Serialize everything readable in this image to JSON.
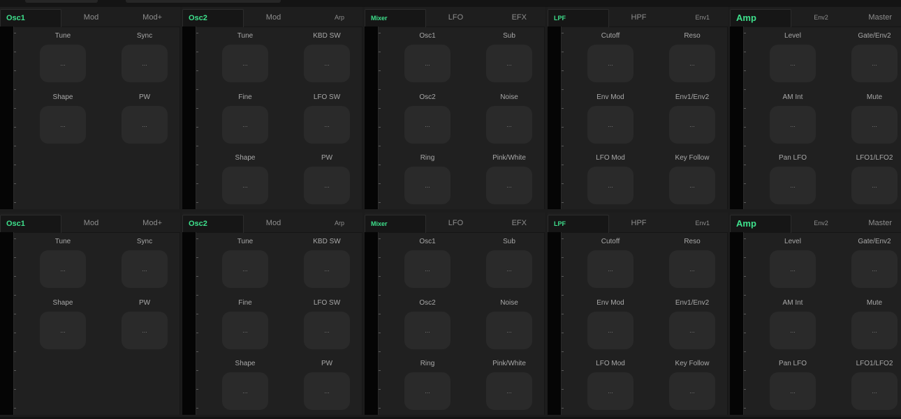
{
  "empty_value": "...",
  "rows": [
    {
      "panels": [
        {
          "tabs": [
            {
              "label": "Osc1",
              "active": true
            },
            {
              "label": "Mod"
            },
            {
              "label": "Mod+"
            }
          ],
          "params": [
            [
              "Tune",
              "Sync"
            ],
            [
              "Shape",
              "PW"
            ]
          ]
        },
        {
          "tabs": [
            {
              "label": "Osc2",
              "active": true
            },
            {
              "label": "Mod"
            },
            {
              "label": "Arp",
              "small": true
            }
          ],
          "params": [
            [
              "Tune",
              "KBD SW"
            ],
            [
              "Fine",
              "LFO SW"
            ],
            [
              "Shape",
              "PW"
            ]
          ]
        },
        {
          "tabs": [
            {
              "label": "Mixer",
              "active": true,
              "small": true
            },
            {
              "label": "LFO"
            },
            {
              "label": "EFX"
            }
          ],
          "params": [
            [
              "Osc1",
              "Sub"
            ],
            [
              "Osc2",
              "Noise"
            ],
            [
              "Ring",
              "Pink/White"
            ]
          ]
        },
        {
          "tabs": [
            {
              "label": "LPF",
              "active": true,
              "small": true
            },
            {
              "label": "HPF"
            },
            {
              "label": "Env1",
              "small": true
            }
          ],
          "params": [
            [
              "Cutoff",
              "Reso"
            ],
            [
              "Env Mod",
              "Env1/Env2"
            ],
            [
              "LFO Mod",
              "Key Follow"
            ]
          ]
        },
        {
          "tabs": [
            {
              "label": "Amp",
              "active": true,
              "big": true
            },
            {
              "label": "Env2",
              "small": true
            },
            {
              "label": "Master"
            }
          ],
          "params": [
            [
              "Level",
              "Gate/Env2"
            ],
            [
              "AM Int",
              "Mute"
            ],
            [
              "Pan LFO",
              "LFO1/LFO2"
            ]
          ]
        }
      ]
    },
    {
      "panels": [
        {
          "tabs": [
            {
              "label": "Osc1",
              "active": true
            },
            {
              "label": "Mod"
            },
            {
              "label": "Mod+"
            }
          ],
          "params": [
            [
              "Tune",
              "Sync"
            ],
            [
              "Shape",
              "PW"
            ]
          ]
        },
        {
          "tabs": [
            {
              "label": "Osc2",
              "active": true
            },
            {
              "label": "Mod"
            },
            {
              "label": "Arp",
              "small": true
            }
          ],
          "params": [
            [
              "Tune",
              "KBD SW"
            ],
            [
              "Fine",
              "LFO SW"
            ],
            [
              "Shape",
              "PW"
            ]
          ]
        },
        {
          "tabs": [
            {
              "label": "Mixer",
              "active": true,
              "small": true
            },
            {
              "label": "LFO"
            },
            {
              "label": "EFX"
            }
          ],
          "params": [
            [
              "Osc1",
              "Sub"
            ],
            [
              "Osc2",
              "Noise"
            ],
            [
              "Ring",
              "Pink/White"
            ]
          ]
        },
        {
          "tabs": [
            {
              "label": "LPF",
              "active": true,
              "small": true
            },
            {
              "label": "HPF"
            },
            {
              "label": "Env1",
              "small": true
            }
          ],
          "params": [
            [
              "Cutoff",
              "Reso"
            ],
            [
              "Env Mod",
              "Env1/Env2"
            ],
            [
              "LFO Mod",
              "Key Follow"
            ]
          ]
        },
        {
          "tabs": [
            {
              "label": "Amp",
              "active": true,
              "big": true
            },
            {
              "label": "Env2",
              "small": true
            },
            {
              "label": "Master"
            }
          ],
          "params": [
            [
              "Level",
              "Gate/Env2"
            ],
            [
              "AM Int",
              "Mute"
            ],
            [
              "Pan LFO",
              "LFO1/LFO2"
            ]
          ]
        }
      ]
    }
  ],
  "colors": {
    "accent": "#3ee08c",
    "background": "#1c1c1c",
    "panel": "#202020",
    "knob": "#2a2a2a",
    "rail": "#050505"
  }
}
